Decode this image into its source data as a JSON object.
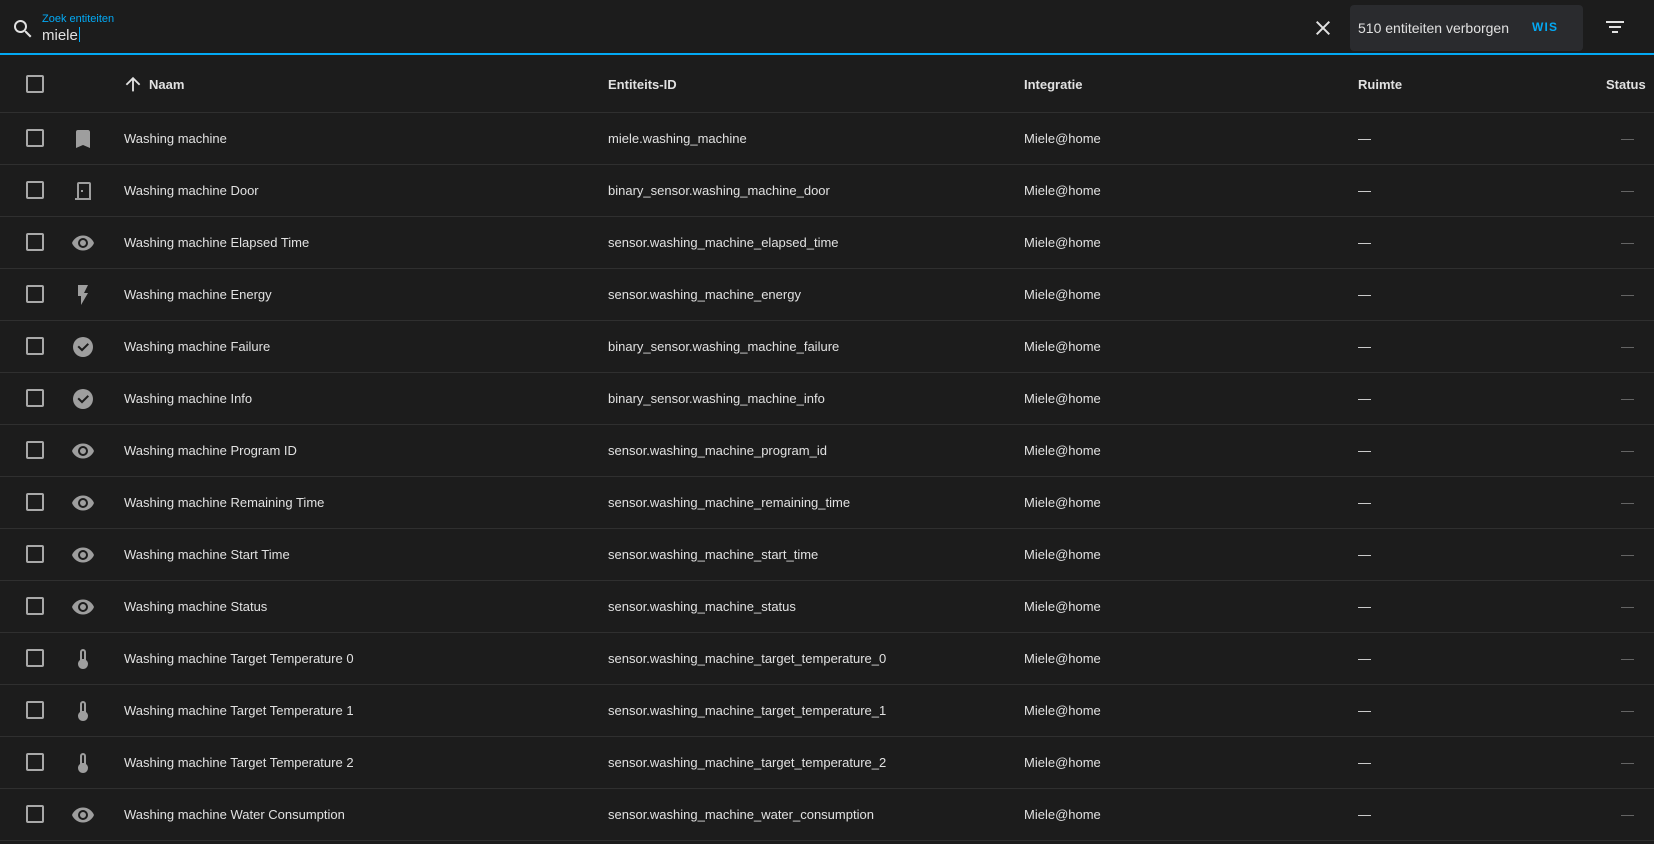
{
  "search": {
    "label": "Zoek entiteiten",
    "value": "miele"
  },
  "toolbar": {
    "hidden_text": "510 entiteiten verborgen",
    "clear_label": "WIS"
  },
  "columns": {
    "name": "Naam",
    "entity_id": "Entiteits-ID",
    "integration": "Integratie",
    "room": "Ruimte",
    "status": "Status"
  },
  "rows": [
    {
      "icon": "bookmark-icon",
      "name": "Washing machine",
      "entity_id": "miele.washing_machine",
      "integration": "Miele@home",
      "room": "—",
      "status": "—"
    },
    {
      "icon": "door-icon",
      "name": "Washing machine Door",
      "entity_id": "binary_sensor.washing_machine_door",
      "integration": "Miele@home",
      "room": "—",
      "status": "—"
    },
    {
      "icon": "eye-icon",
      "name": "Washing machine Elapsed Time",
      "entity_id": "sensor.washing_machine_elapsed_time",
      "integration": "Miele@home",
      "room": "—",
      "status": "—"
    },
    {
      "icon": "flash-icon",
      "name": "Washing machine Energy",
      "entity_id": "sensor.washing_machine_energy",
      "integration": "Miele@home",
      "room": "—",
      "status": "—"
    },
    {
      "icon": "check-circle-icon",
      "name": "Washing machine Failure",
      "entity_id": "binary_sensor.washing_machine_failure",
      "integration": "Miele@home",
      "room": "—",
      "status": "—"
    },
    {
      "icon": "check-circle-icon",
      "name": "Washing machine Info",
      "entity_id": "binary_sensor.washing_machine_info",
      "integration": "Miele@home",
      "room": "—",
      "status": "—"
    },
    {
      "icon": "eye-icon",
      "name": "Washing machine Program ID",
      "entity_id": "sensor.washing_machine_program_id",
      "integration": "Miele@home",
      "room": "—",
      "status": "—"
    },
    {
      "icon": "eye-icon",
      "name": "Washing machine Remaining Time",
      "entity_id": "sensor.washing_machine_remaining_time",
      "integration": "Miele@home",
      "room": "—",
      "status": "—"
    },
    {
      "icon": "eye-icon",
      "name": "Washing machine Start Time",
      "entity_id": "sensor.washing_machine_start_time",
      "integration": "Miele@home",
      "room": "—",
      "status": "—"
    },
    {
      "icon": "eye-icon",
      "name": "Washing machine Status",
      "entity_id": "sensor.washing_machine_status",
      "integration": "Miele@home",
      "room": "—",
      "status": "—"
    },
    {
      "icon": "thermometer-icon",
      "name": "Washing machine Target Temperature 0",
      "entity_id": "sensor.washing_machine_target_temperature_0",
      "integration": "Miele@home",
      "room": "—",
      "status": "—"
    },
    {
      "icon": "thermometer-icon",
      "name": "Washing machine Target Temperature 1",
      "entity_id": "sensor.washing_machine_target_temperature_1",
      "integration": "Miele@home",
      "room": "—",
      "status": "—"
    },
    {
      "icon": "thermometer-icon",
      "name": "Washing machine Target Temperature 2",
      "entity_id": "sensor.washing_machine_target_temperature_2",
      "integration": "Miele@home",
      "room": "—",
      "status": "—"
    },
    {
      "icon": "eye-icon",
      "name": "Washing machine Water Consumption",
      "entity_id": "sensor.washing_machine_water_consumption",
      "integration": "Miele@home",
      "room": "—",
      "status": "—"
    }
  ],
  "colors": {
    "accent": "#03a9f4",
    "background": "#1c1c1c",
    "icon": "#9e9e9e"
  }
}
